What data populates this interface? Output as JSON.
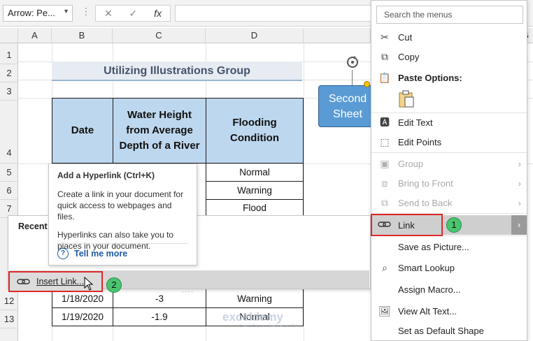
{
  "formula_bar": {
    "name_box": "Arrow: Pe...",
    "cancel_symbol": "✕",
    "enter_symbol": "✓",
    "fx_symbol": "fx"
  },
  "columns": [
    "A",
    "B",
    "C",
    "D",
    "G"
  ],
  "rows": [
    "1",
    "2",
    "3",
    "4",
    "5",
    "6",
    "7",
    "12",
    "13"
  ],
  "sheet_title": "Utilizing Illustrations Group",
  "table": {
    "headers": [
      "Date",
      "Water Height from Average Depth of a River",
      "Flooding Condition"
    ],
    "visible_conditions": [
      "Normal",
      "Warning",
      "Flood"
    ],
    "bottom_rows": [
      {
        "date": "1/18/2020",
        "height": "-3",
        "condition": "Warning"
      },
      {
        "date": "1/19/2020",
        "height": "-1.9",
        "condition": "Normal"
      }
    ]
  },
  "shape_text": "Second Sheet",
  "tooltip": {
    "title": "Add a Hyperlink (Ctrl+K)",
    "p1": "Create a link in your document for quick access to webpages and files.",
    "p2": "Hyperlinks can also take you to places in your document.",
    "more": "Tell me more"
  },
  "submenu": {
    "recent": "Recent",
    "insert_link": "Insert Link..."
  },
  "badges": {
    "one": "1",
    "two": "2"
  },
  "context_menu": {
    "search_placeholder": "Search the menus",
    "cut": "Cut",
    "copy": "Copy",
    "paste_options": "Paste Options:",
    "edit_text": "Edit Text",
    "edit_points": "Edit Points",
    "group": "Group",
    "bring_to_front": "Bring to Front",
    "send_to_back": "Send to Back",
    "link": "Link",
    "save_as_picture": "Save as Picture...",
    "smart_lookup": "Smart Lookup",
    "assign_macro": "Assign Macro...",
    "view_alt_text": "View Alt Text...",
    "set_default_shape": "Set as Default Shape"
  },
  "watermark": {
    "name": "exceldemy",
    "tag": "EXCEL · DATA · BI"
  },
  "colors": {
    "header_fill": "#bdd7ee",
    "shape_fill": "#5b9bd5",
    "highlight_red": "#e02828",
    "badge_green": "#4ac46e"
  }
}
